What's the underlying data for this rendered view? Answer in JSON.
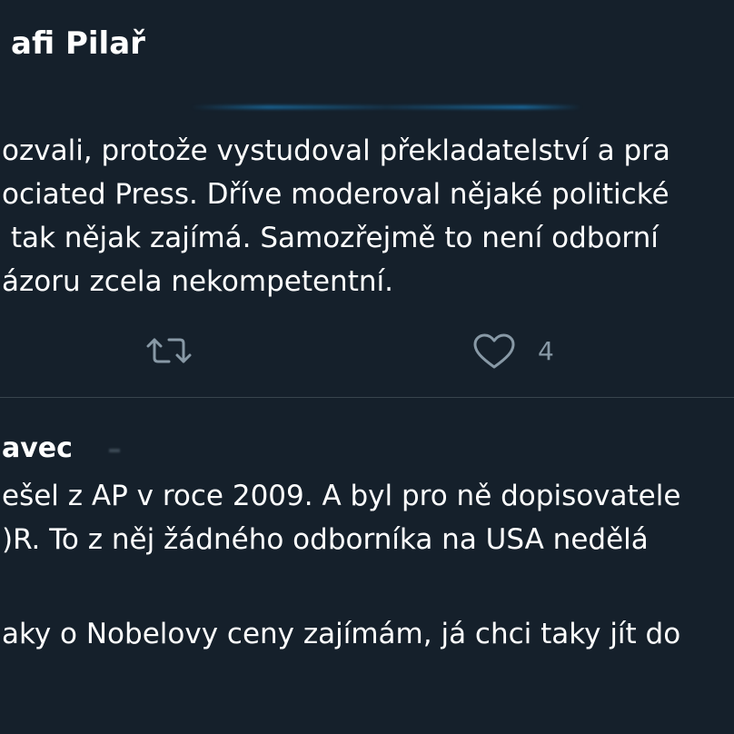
{
  "tweet": {
    "author_name": "afi Pilař",
    "text_lines": [
      "ozvali, protože vystudoval překladatelství a pra",
      "ociated Press. Dříve moderoval nějaké politické",
      " tak nějak zajímá. Samozřejmě to není odborní",
      "ázoru zcela nekompetentní."
    ],
    "like_count": "4"
  },
  "reply": {
    "author_name": "avec",
    "text_lines": [
      "ešel z AP v roce 2009. A byl pro ně dopisovatele",
      ")R. To z něj žádného odborníka na USA nedělá"
    ],
    "text_lines_2": [
      "aky o Nobelovy ceny zajímám, já chci taky jít do"
    ]
  },
  "icons": {
    "retweet": "retweet-icon",
    "like": "heart-icon"
  },
  "colors": {
    "background": "#15202b",
    "text": "#ffffff",
    "muted": "#8899a6",
    "divider": "#38444d"
  }
}
